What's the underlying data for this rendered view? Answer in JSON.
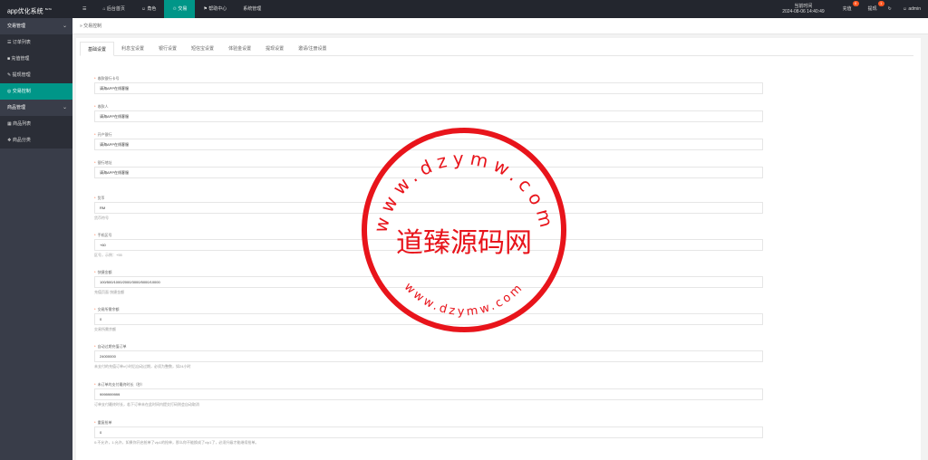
{
  "app": {
    "title": "app优化系统",
    "version": "BeTA"
  },
  "topnav": [
    {
      "label": "后台首页",
      "icon": "home-icon",
      "glyph": "⌂"
    },
    {
      "label": "角色",
      "icon": "user-icon",
      "glyph": "☺"
    },
    {
      "label": "交易",
      "icon": "trade-icon",
      "glyph": "♲",
      "active": true
    },
    {
      "label": "帮助中心",
      "icon": "flag-icon",
      "glyph": "⚑"
    },
    {
      "label": "系统管理",
      "icon": "",
      "glyph": ""
    }
  ],
  "header": {
    "time_label": "当前时间",
    "time_value": "2024-08-06 14:40:49",
    "recharge_label": "充值",
    "recharge_badge": "0",
    "withdraw_label": "提现",
    "withdraw_badge": "1",
    "refresh_glyph": "↻",
    "user_label": "admin"
  },
  "sidebar": {
    "groups": [
      {
        "label": "交易管理",
        "items": [
          {
            "label": "订单列表",
            "glyph": "☰"
          },
          {
            "label": "充值管理",
            "glyph": "■"
          },
          {
            "label": "提现管理",
            "glyph": "✎"
          },
          {
            "label": "交易控制",
            "glyph": "◎",
            "active": true
          }
        ]
      },
      {
        "label": "商品管理",
        "items": [
          {
            "label": "商品列表",
            "glyph": "▦"
          },
          {
            "label": "商品分类",
            "glyph": "❖"
          }
        ]
      }
    ]
  },
  "breadcrumb": "交易控制",
  "tabs": [
    "基础设置",
    "利息宝设置",
    "银行设置",
    "短信宝设置",
    "体验金设置",
    "提现设置",
    "邀请/注册设置"
  ],
  "fields": [
    {
      "label": "收款银行卡号",
      "value": "请海APP在线客服",
      "hint": ""
    },
    {
      "label": "收款人",
      "value": "请海APP在线客服",
      "hint": ""
    },
    {
      "label": "开户银行",
      "value": "请海APP在线客服",
      "hint": ""
    },
    {
      "label": "银行地址",
      "value": "请海APP在线客服",
      "hint": ""
    },
    {
      "label": "货币",
      "value": "RM",
      "hint": "货币符号"
    },
    {
      "label": "手机区号",
      "value": "+60",
      "hint": "区号，示例：+55"
    },
    {
      "label": "快捷金额",
      "value": "100/500/1000/2000/3000/5000/10000",
      "hint": "充值页面 快捷金额"
    },
    {
      "label": "交易所需余额",
      "value": "0",
      "hint": "交易所需余额"
    },
    {
      "label": "自动过期充值订单",
      "value": "24000000",
      "hint": "未支付的充值订单x小时后自动过期，必须为整数，如24小时"
    },
    {
      "label": "未订单的支付最终时长（秒）",
      "value": "9999999999",
      "hint": "订单支付最终时长，若下订单未在此时间内提交打码则会自动取消"
    },
    {
      "label": "重复抢单",
      "value": "0",
      "hint": "0:不允许，1:允许，如果你开启抢单了vip1的抢单，那么你不能换成了vip1了，必须升级才能继续抢单。"
    }
  ],
  "watermark": {
    "center_text": "道臻源码网",
    "ring_top": "www.dzymw.com",
    "ring_bottom": "www.dzymw.com",
    "color": "#e8141b"
  },
  "colors": {
    "accent": "#009688",
    "sidebar": "#393d49",
    "topbar": "#23262e",
    "badge": "#ff5722"
  }
}
